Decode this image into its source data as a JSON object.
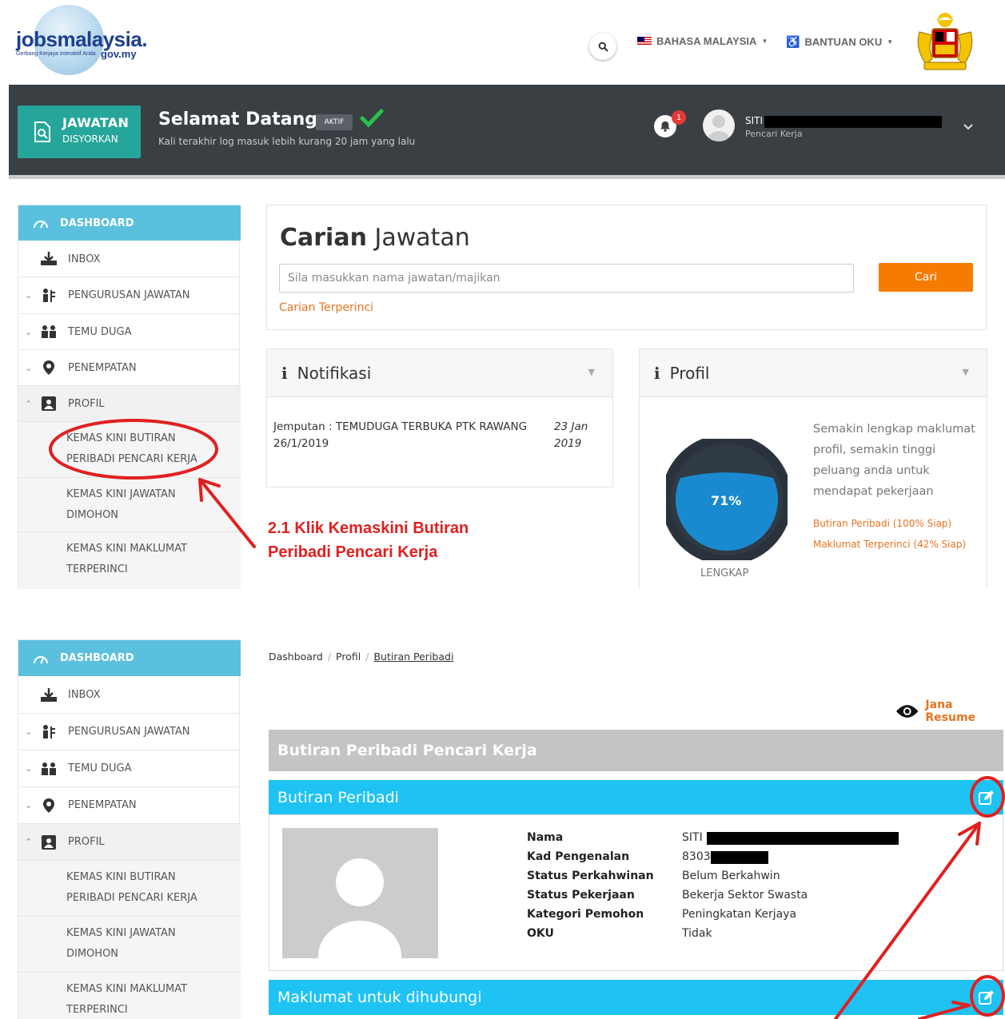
{
  "header": {
    "logo_main": "jobsmalaysia.",
    "logo_tagline": "Gerbang Kerjaya Interaktif Anda",
    "logo_domain": "gov.my",
    "language_label": "BAHASA MALAYSIA",
    "oku_label": "BANTUAN OKU"
  },
  "topbar": {
    "jawatan_line1": "JAWATAN",
    "jawatan_line2": "DISYORKAN",
    "welcome": "Selamat Datang",
    "status_badge": "AKTIF",
    "last_login": "Kali terakhir log masuk lebih kurang 20 jam yang lalu",
    "notification_count": "1",
    "user_name": "SITI",
    "user_role": "Pencari Kerja"
  },
  "sidebar": {
    "items": [
      {
        "label": "DASHBOARD"
      },
      {
        "label": "INBOX"
      },
      {
        "label": "PENGURUSAN JAWATAN"
      },
      {
        "label": "TEMU DUGA"
      },
      {
        "label": "PENEMPATAN"
      },
      {
        "label": "PROFIL"
      }
    ],
    "sub_items": [
      {
        "line1": "KEMAS KINI BUTIRAN",
        "line2": "PERIBADI PENCARI KERJA"
      },
      {
        "line1": "KEMAS KINI JAWATAN",
        "line2": "DIMOHON"
      },
      {
        "line1": "KEMAS KINI MAKLUMAT",
        "line2": "TERPERINCI"
      }
    ]
  },
  "search": {
    "title_bold": "Carian",
    "title_light": "Jawatan",
    "placeholder": "Sila masukkan nama jawatan/majikan",
    "button": "Cari",
    "advanced_link": "Carian Terperinci"
  },
  "notifikasi": {
    "title": "Notifikasi",
    "item_text": "Jemputan : TEMUDUGA TERBUKA PTK RAWANG 26/1/2019",
    "item_date": "23 Jan 2019"
  },
  "profil": {
    "title": "Profil",
    "percent": "71%",
    "progress": 0.71,
    "status_label": "LENGKAP",
    "description": "Semakin lengkap maklumat profil, semakin tinggi peluang anda untuk mendapat pekerjaan",
    "line_personal": "Butiran Peribadi (100% Siap)",
    "line_detail": "Maklumat Terperinci (42% Siap)"
  },
  "annotation": {
    "line1": "2.1  Klik Kemaskini Butiran",
    "line2": "Peribadi Pencari Kerja",
    "color": "#e02020"
  },
  "detail_page": {
    "breadcrumb": [
      "Dashboard",
      "Profil",
      "Butiran Peribadi"
    ],
    "resume_link": "Jana Resume",
    "page_heading": "Butiran Peribadi Pencari Kerja",
    "section_personal": "Butiran Peribadi",
    "section_contact": "Maklumat untuk dihubungi",
    "fields": [
      {
        "label": "Nama",
        "value": "SITI"
      },
      {
        "label": "Kad Pengenalan",
        "value": "8303"
      },
      {
        "label": "Status Perkahwinan",
        "value": "Belum Berkahwin"
      },
      {
        "label": "Status Pekerjaan",
        "value": "Bekerja Sektor Swasta"
      },
      {
        "label": "Kategori Pemohon",
        "value": "Peningkatan Kerjaya"
      },
      {
        "label": "OKU",
        "value": "Tidak"
      }
    ]
  },
  "colors": {
    "accent_blue": "#1ec3f3",
    "sidebar_active": "#5bc0de",
    "teal": "#26a69a",
    "orange": "#f57c00",
    "dark_bar": "#3a3f44"
  }
}
